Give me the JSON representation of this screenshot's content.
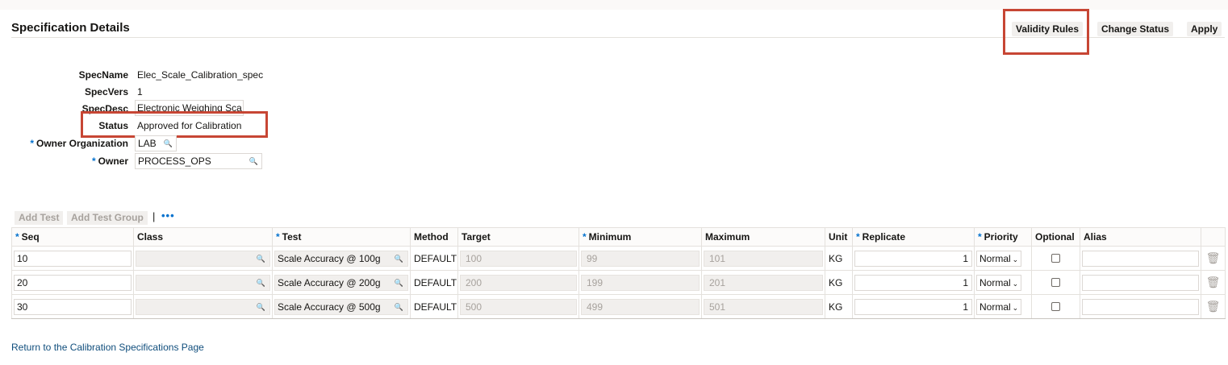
{
  "header": {
    "title": "Specification Details",
    "buttons": {
      "validity_rules": "Validity Rules",
      "change_status": "Change Status",
      "apply": "Apply"
    }
  },
  "form": {
    "spec_name": {
      "label": "SpecName",
      "value": "Elec_Scale_Calibration_spec"
    },
    "spec_vers": {
      "label": "SpecVers",
      "value": "1"
    },
    "spec_desc": {
      "label": "SpecDesc",
      "value": "Electronic Weighing Sca"
    },
    "status": {
      "label": "Status",
      "value": "Approved for Calibration"
    },
    "owner_org": {
      "label": "Owner Organization",
      "value": "LAB"
    },
    "owner": {
      "label": "Owner",
      "value": "PROCESS_OPS"
    },
    "required_mark": "*"
  },
  "toolbar": {
    "add_test": "Add Test",
    "add_test_group": "Add Test Group",
    "separator": "|",
    "more": "•••"
  },
  "table": {
    "columns": {
      "seq": "Seq",
      "class": "Class",
      "test": "Test",
      "method": "Method",
      "target": "Target",
      "minimum": "Minimum",
      "maximum": "Maximum",
      "unit": "Unit",
      "replicate": "Replicate",
      "priority": "Priority",
      "optional": "Optional",
      "alias": "Alias"
    },
    "rows": [
      {
        "seq": "10",
        "class": "",
        "test": "Scale Accuracy @ 100g",
        "method": "DEFAULT",
        "target": "100",
        "minimum": "99",
        "maximum": "101",
        "unit": "KG",
        "replicate": "1",
        "priority": "Normal",
        "optional": false,
        "alias": ""
      },
      {
        "seq": "20",
        "class": "",
        "test": "Scale Accuracy @ 200g",
        "method": "DEFAULT",
        "target": "200",
        "minimum": "199",
        "maximum": "201",
        "unit": "KG",
        "replicate": "1",
        "priority": "Normal",
        "optional": false,
        "alias": ""
      },
      {
        "seq": "30",
        "class": "",
        "test": "Scale Accuracy @ 500g",
        "method": "DEFAULT",
        "target": "500",
        "minimum": "499",
        "maximum": "501",
        "unit": "KG",
        "replicate": "1",
        "priority": "Normal",
        "optional": false,
        "alias": ""
      }
    ]
  },
  "footer": {
    "return_link": "Return to the Calibration Specifications Page"
  },
  "colors": {
    "required_asterisk": "#0572ce",
    "highlight_box": "#c74634",
    "link": "#0f4d7c"
  }
}
